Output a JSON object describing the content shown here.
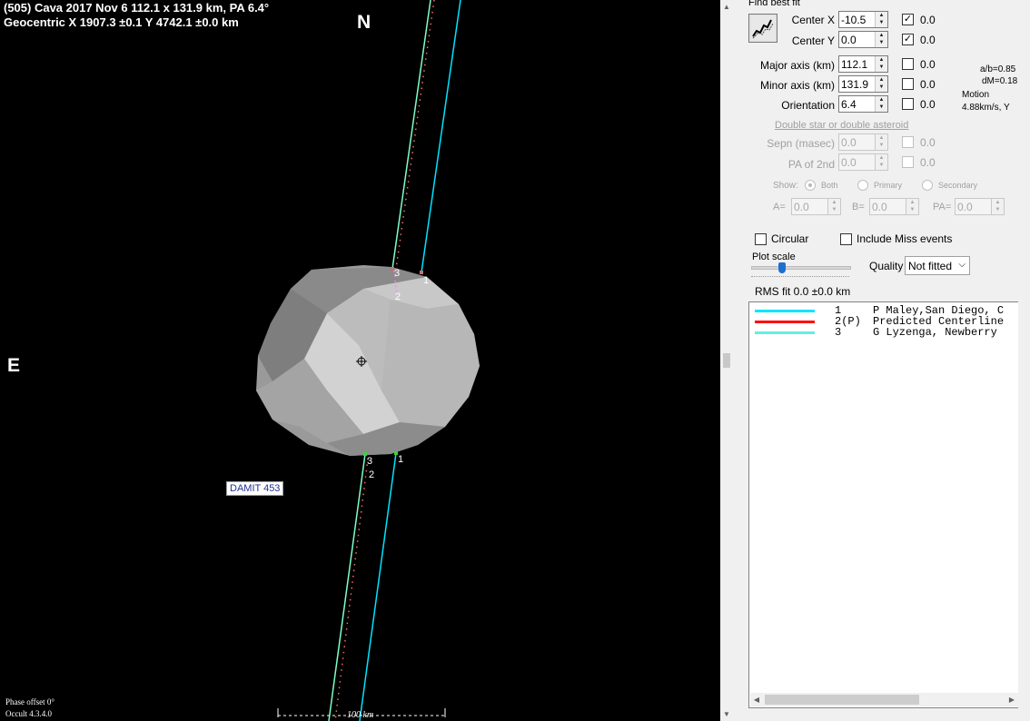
{
  "plot": {
    "header_line1": "(505) Cava  2017 Nov 6  112.1 x 131.9 km, PA 6.4°",
    "header_line2": "Geocentric  X  1907.3 ±0.1  Y 4742.1 ±0.0 km",
    "north": "N",
    "east": "E",
    "damit_label": "DAMIT 453",
    "phase_offset": "Phase offset 0°",
    "version": "Occult 4.3.4.0",
    "scale_label": "100 km",
    "chord_labels": {
      "c1": "1",
      "c2": "2",
      "c3": "3"
    },
    "colors": {
      "background": "#000000",
      "chord1": "#00e5ff",
      "chord3": "#7dffc8",
      "predicted": "#ff6a6a",
      "shape": "#bdbdbd"
    }
  },
  "panel": {
    "find_best_fit": "Find best fit",
    "center_x": {
      "label": "Center X",
      "value": "-10.5",
      "checked": true,
      "result": "0.0"
    },
    "center_y": {
      "label": "Center Y",
      "value": "0.0",
      "checked": true,
      "result": "0.0"
    },
    "major_axis": {
      "label": "Major axis (km)",
      "value": "112.1",
      "checked": false,
      "result": "0.0"
    },
    "minor_axis": {
      "label": "Minor axis (km)",
      "value": "131.9",
      "checked": false,
      "result": "0.0"
    },
    "orientation": {
      "label": "Orientation",
      "value": "6.4",
      "checked": false,
      "result": "0.0"
    },
    "ab_ratio": "a/b=0.85",
    "dm": "dM=0.18",
    "motion_label": "Motion",
    "motion_value": "4.88km/s, Y",
    "double_star": "Double star  or  double asteroid",
    "sepn": {
      "label": "Sepn (masec)",
      "value": "0.0",
      "result": "0.0"
    },
    "pa2nd": {
      "label": "PA of 2nd",
      "value": "0.0",
      "result": "0.0"
    },
    "show_label": "Show:",
    "show_both": "Both",
    "show_primary": "Primary",
    "show_secondary": "Secondary",
    "a_label": "A=",
    "a_value": "0.0",
    "b_label": "B=",
    "b_value": "0.0",
    "pa_label": "PA=",
    "pa_value": "0.0",
    "circular": "Circular",
    "include_miss": "Include Miss events",
    "plot_scale": "Plot scale",
    "quality_label": "Quality",
    "quality_value": "Not fitted",
    "rms_fit": "RMS fit  0.0 ±0.0 km",
    "legend": [
      {
        "num": "1   ",
        "text": "P Maley,San Diego, C",
        "color": "#00e5ff"
      },
      {
        "num": "2(P)",
        "text": "Predicted Centerline",
        "color": "#ff0000"
      },
      {
        "num": "3   ",
        "text": "G Lyzenga, Newberry ",
        "color": "#66eedd"
      }
    ]
  }
}
